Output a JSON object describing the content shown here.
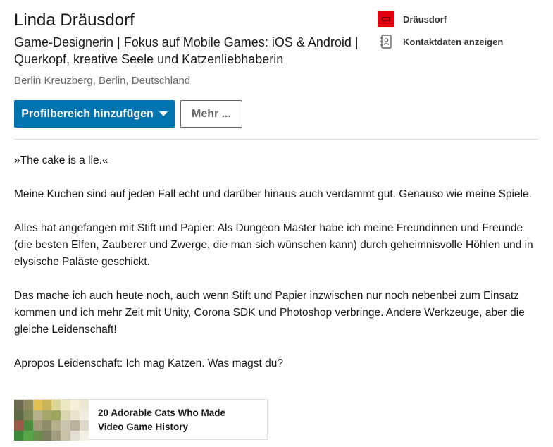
{
  "profile": {
    "name": "Linda Dräusdorf",
    "headline": "Game-Designerin | Fokus auf Mobile Games: iOS & Android | Querkopf, kreative Seele und Katzenliebhaberin",
    "location": "Berlin Kreuzberg, Berlin, Deutschland"
  },
  "sidebar": {
    "company_label": "Dräusdorf",
    "company_icon": "company-logo-icon",
    "contact_label": "Kontaktdaten anzeigen",
    "contact_icon": "contact-card-icon"
  },
  "actions": {
    "primary_label": "Profilbereich hinzufügen",
    "secondary_label": "Mehr ..."
  },
  "summary": {
    "paragraphs": [
      "»The cake is a lie.«",
      "Meine Kuchen sind auf jeden Fall echt und darüber hinaus auch verdammt gut. Genauso wie meine Spiele.",
      "Alles hat angefangen mit Stift und Papier: Als Dungeon Master habe ich meine Freundinnen und Freunde (die besten Elfen, Zauberer und Zwerge, die man sich wünschen kann) durch geheimnisvolle Höhlen und in elysische Paläste geschickt.",
      "Das mache ich auch heute noch, auch wenn Stift und Papier inzwischen nur noch nebenbei zum Einsatz kommen und ich mehr Zeit mit Unity, Corona SDK und Photoshop verbringe. Andere Werkzeuge, aber die gleiche Leidenschaft!",
      "Apropos Leidenschaft: Ich mag Katzen. Was magst du?"
    ]
  },
  "media": {
    "title": "20 Adorable Cats Who Made Video Game History",
    "thumbnail_colors": [
      "#6b6a4f",
      "#8f8a5e",
      "#e0c152",
      "#c9b45a",
      "#d8d596",
      "#ece7c4",
      "#f3efd9",
      "#ece7d0",
      "#5f6a44",
      "#7d8856",
      "#b7b08a",
      "#a6a76b",
      "#9ca55e",
      "#d9d5b0",
      "#e7e3cf",
      "#efece0",
      "#9b5a49",
      "#4c8a3d",
      "#a39a7b",
      "#8f8d6b",
      "#b5ae88",
      "#c9c4ae",
      "#b9b39e",
      "#dcd8c8",
      "#3f8a3a",
      "#58a648",
      "#6b8f4a",
      "#7d7e5d",
      "#a29c7e",
      "#c8c2a8",
      "#e3dfd1",
      "#f1efe6"
    ]
  }
}
